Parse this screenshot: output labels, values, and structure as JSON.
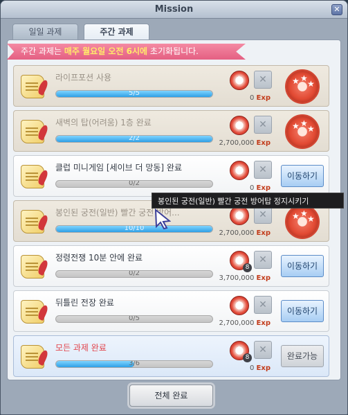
{
  "window": {
    "title": "Mission"
  },
  "tabs": [
    {
      "label": "일일 과제"
    },
    {
      "label": "주간 과제"
    }
  ],
  "notice": {
    "before": "주간 과제는 ",
    "highlight": "매주 월요일 오전 6시에",
    "after": " 초기화됩니다."
  },
  "missions": [
    {
      "title": "라이프포션 사용",
      "progress": "5/5",
      "progress_ratio": 1.0,
      "exp_amount": "0",
      "exp_label": "Exp",
      "state": "completed"
    },
    {
      "title": "새벽의 탑(어려움) 1층 완료",
      "progress": "2/2",
      "progress_ratio": 1.0,
      "exp_amount": "2,700,000",
      "exp_label": "Exp",
      "state": "completed"
    },
    {
      "title": "클럽 미니게임 [세이브 더 망동] 완료",
      "progress": "0/2",
      "progress_ratio": 0.0,
      "exp_amount": "0",
      "exp_label": "Exp",
      "action": "이동하기",
      "state": "active"
    },
    {
      "title": "봉인된 궁전(일반) 빨간 궁전 방어...",
      "progress": "10/10",
      "progress_ratio": 1.0,
      "exp_amount": "2,700,000",
      "exp_label": "Exp",
      "state": "completed"
    },
    {
      "title": "정령전쟁 10분 안에 완료",
      "progress": "0/2",
      "progress_ratio": 0.0,
      "exp_amount": "3,700,000",
      "exp_label": "Exp",
      "reward_count": "8",
      "action": "이동하기",
      "state": "active"
    },
    {
      "title": "뒤틀린 전장 완료",
      "progress": "0/5",
      "progress_ratio": 0.0,
      "exp_amount": "2,700,000",
      "exp_label": "Exp",
      "action": "이동하기",
      "state": "active"
    },
    {
      "title": "모든 과제 완료",
      "progress": "3/6",
      "progress_ratio": 0.5,
      "exp_amount": "0",
      "exp_label": "Exp",
      "reward_count": "8",
      "action": "완료가능",
      "state": "final"
    }
  ],
  "bottom_button": "전체 완료",
  "tooltip": "봉인된 궁전(일반) 빨간 궁전 방어탑 정지시키기",
  "colors": {
    "notice_bg": "#e45f82",
    "notice_highlight": "#ffe96a",
    "progress_fill": "#2fa0e6",
    "final_title": "#e2444b",
    "exp_label": "#c23b1a"
  }
}
